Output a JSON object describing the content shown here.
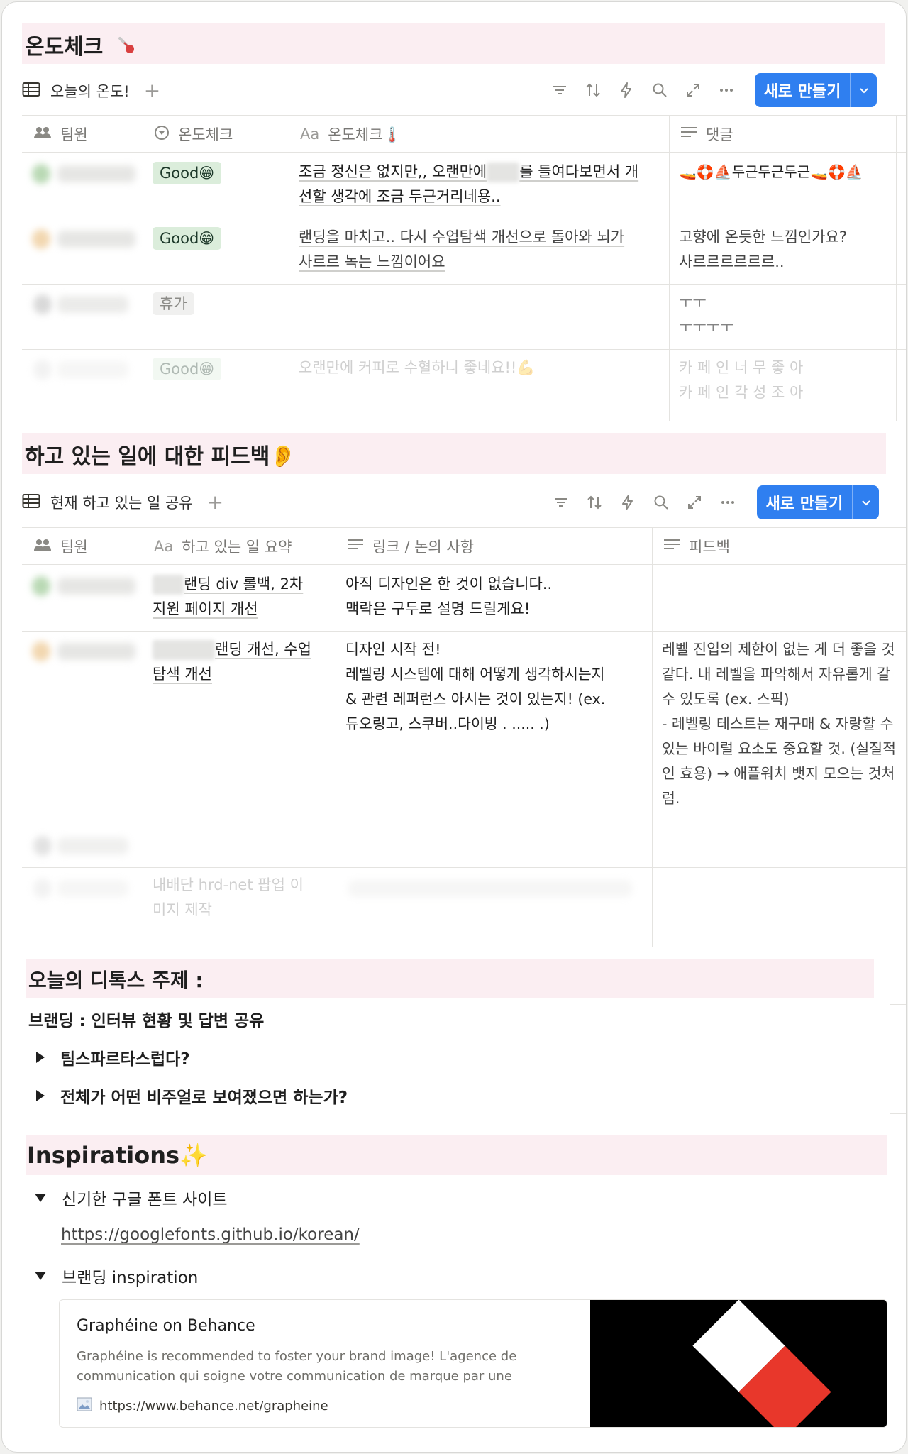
{
  "section1": {
    "title": "온도체크",
    "view_tab": "오늘의 온도!",
    "new_button": "새로 만들기",
    "columns": [
      "팀원",
      "온도체크",
      "온도체크🌡️",
      "댓글"
    ],
    "columns_prefix": [
      "",
      "",
      "Aa",
      ""
    ],
    "rows": [
      {
        "tag": "Good😁",
        "text_a": "조금 정신은 없지만,, 오랜만에",
        "text_b": "를 들여다보면서 개",
        "text_c": "선할 생각에 조금 두근거리네용..",
        "comment_1": "🚤🛟⛵두근두근두근🚤🛟⛵",
        "comment_2": ""
      },
      {
        "tag": "Good😁",
        "text_a": "랜딩을 마치고.. 다시 수업탐색 개선으로 돌아와 뇌가",
        "text_b": "",
        "text_c": "사르르 녹는 느낌이어요",
        "comment_1": "고향에 온듯한 느낌인가요?",
        "comment_2": "사르르르르르르.."
      },
      {
        "tag": "휴가",
        "text_a": "",
        "text_b": "",
        "text_c": "",
        "comment_1": "ㅜㅜ",
        "comment_2": "ㅜㅜㅜㅜ"
      },
      {
        "tag": "Good😁",
        "text_a": "오랜만에 커피로 수혈하니 좋네요!!💪",
        "text_b": "",
        "text_c": "",
        "comment_1": "카 페 인 너 무 좋 아",
        "comment_2": "카 페 인 각 성 조 아"
      }
    ]
  },
  "section2": {
    "title": "하고 있는 일에 대한 피드백👂",
    "view_tab": "현재 하고 있는 일 공유",
    "new_button": "새로 만들기",
    "columns": [
      "팀원",
      "하고 있는 일 요약",
      "링크 / 논의 사항",
      "피드백"
    ],
    "columns_prefix": [
      "",
      "Aa",
      "",
      ""
    ],
    "rows": [
      {
        "summary": [
          "랜딩 div 롤백, 2차",
          "지원 페이지 개선"
        ],
        "notes": [
          "아직 디자인은 한 것이 없습니다..",
          "맥락은 구두로 설명 드릴게요!"
        ],
        "feedback": []
      },
      {
        "summary": [
          "랜딩 개선, 수업",
          "탐색 개선"
        ],
        "notes": [
          "디자인 시작 전!",
          "레벨링 시스템에 대해 어떻게 생각하시는지",
          "& 관련 레퍼런스 아시는 것이 있는지! (ex.",
          "듀오링고, 스쿠버..다이빙 . ..... .)"
        ],
        "feedback": [
          "레벨 진입의 제한이 없는 게 더 좋을 것",
          "같다. 내 레벨을 파악해서 자유롭게 갈",
          "수 있도록 (ex. 스픽)",
          "- 레벨링 테스트는 재구매 & 자랑할 수",
          "있는 바이럴 요소도 중요할 것. (실질적",
          "인 효용) → 애플워치 뱃지 모으는 것처",
          "럼."
        ]
      },
      {
        "summary": [],
        "notes": [],
        "feedback": []
      },
      {
        "summary": [
          "내배단 hrd-net 팝업 이",
          "미지 제작"
        ],
        "notes": [],
        "feedback": []
      }
    ]
  },
  "section3": {
    "title": "오늘의 디톡스 주제 :",
    "subtitle": "브랜딩 : 인터뷰 현황 및 답변 공유",
    "toggles": [
      "팀스파르타스럽다?",
      "전체가 어떤 비주얼로 보여졌으면 하는가?"
    ]
  },
  "section4": {
    "title": "Inspirations✨",
    "toggles": [
      "신기한 구글 폰트 사이트",
      "브랜딩 inspiration"
    ],
    "link": "https://googlefonts.github.io/korean/",
    "bookmark": {
      "title": "Graphéine on Behance",
      "desc_1": "Graphéine is recommended to foster your brand image! L'agence de",
      "desc_2": "communication qui soigne votre communication de marque par une",
      "url": "https://www.behance.net/grapheine"
    }
  },
  "colors": {
    "band": "#fbeef2",
    "accent": "#2f7ff0",
    "tag_green": "#dbeddb",
    "tag_gray": "#ededeb"
  },
  "icons": [
    "thermometer-icon",
    "table-view-icon",
    "plus-icon",
    "filter-icon",
    "sort-icon",
    "lightning-icon",
    "search-icon",
    "expand-icon",
    "more-icon",
    "chevron-down-icon",
    "people-icon",
    "status-icon",
    "text-lines-icon",
    "favicon-icon"
  ]
}
